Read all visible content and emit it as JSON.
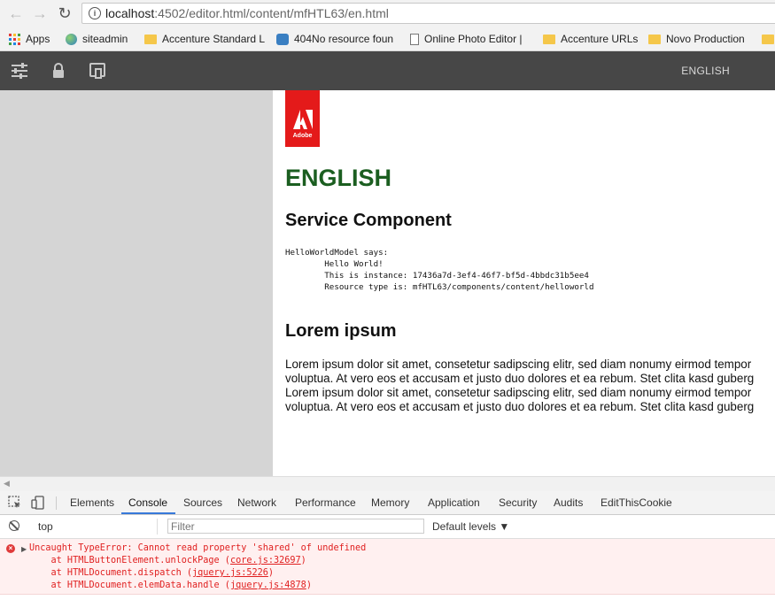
{
  "browser": {
    "url_host": "localhost",
    "url_rest": ":4502/editor.html/content/mfHTL63/en.html"
  },
  "bookmarks": [
    {
      "label": "Apps",
      "icon": "apps-grid-icon"
    },
    {
      "label": "siteadmin",
      "icon": "globe-icon"
    },
    {
      "label": "Accenture Standard L",
      "icon": "folder-icon"
    },
    {
      "label": "404No resource foun",
      "icon": "puzzle-icon"
    },
    {
      "label": "Online Photo Editor |",
      "icon": "document-icon"
    },
    {
      "label": "Accenture URLs",
      "icon": "folder-icon"
    },
    {
      "label": "Novo Production",
      "icon": "folder-icon"
    }
  ],
  "editor": {
    "title": "ENGLISH",
    "toolbar_icons": [
      "sliders-icon",
      "lock-icon",
      "emulator-icon"
    ]
  },
  "page": {
    "logo_text": "Adobe",
    "heading": "ENGLISH",
    "service_heading": "Service Component",
    "service_output": "HelloWorldModel says:\n        Hello World!\n        This is instance: 17436a7d-3ef4-46f7-bf5d-4bbdc31b5ee4\n        Resource type is: mfHTL63/components/content/helloworld",
    "lorem_heading": "Lorem ipsum",
    "lorem_lines": [
      "Lorem ipsum dolor sit amet, consetetur sadipscing elitr, sed diam nonumy eirmod tempor",
      "voluptua. At vero eos et accusam et justo duo dolores et ea rebum. Stet clita kasd guberg",
      "Lorem ipsum dolor sit amet, consetetur sadipscing elitr, sed diam nonumy eirmod tempor",
      "voluptua. At vero eos et accusam et justo duo dolores et ea rebum. Stet clita kasd guberg"
    ]
  },
  "devtools": {
    "tabs": [
      "Elements",
      "Console",
      "Sources",
      "Network",
      "Performance",
      "Memory",
      "Application",
      "Security",
      "Audits",
      "EditThisCookie"
    ],
    "active_tab": "Console",
    "context": "top",
    "filter_placeholder": "Filter",
    "levels_label": "Default levels ▼"
  },
  "console": {
    "error_message": "Uncaught TypeError: Cannot read property 'shared' of undefined",
    "stack": [
      {
        "prefix": "    at HTMLButtonElement.unlockPage (",
        "link": "core.js:32697",
        "suffix": ")"
      },
      {
        "prefix": "    at HTMLDocument.dispatch (",
        "link": "jquery.js:5226",
        "suffix": ")"
      },
      {
        "prefix": "    at HTMLDocument.elemData.handle (",
        "link": "jquery.js:4878",
        "suffix": ")"
      }
    ]
  },
  "colors": {
    "editor_bar": "#474747",
    "heading_green": "#1b5e20",
    "adobe_red": "#e41a1a",
    "error_red": "#e02020",
    "active_tab_blue": "#3879d9"
  }
}
